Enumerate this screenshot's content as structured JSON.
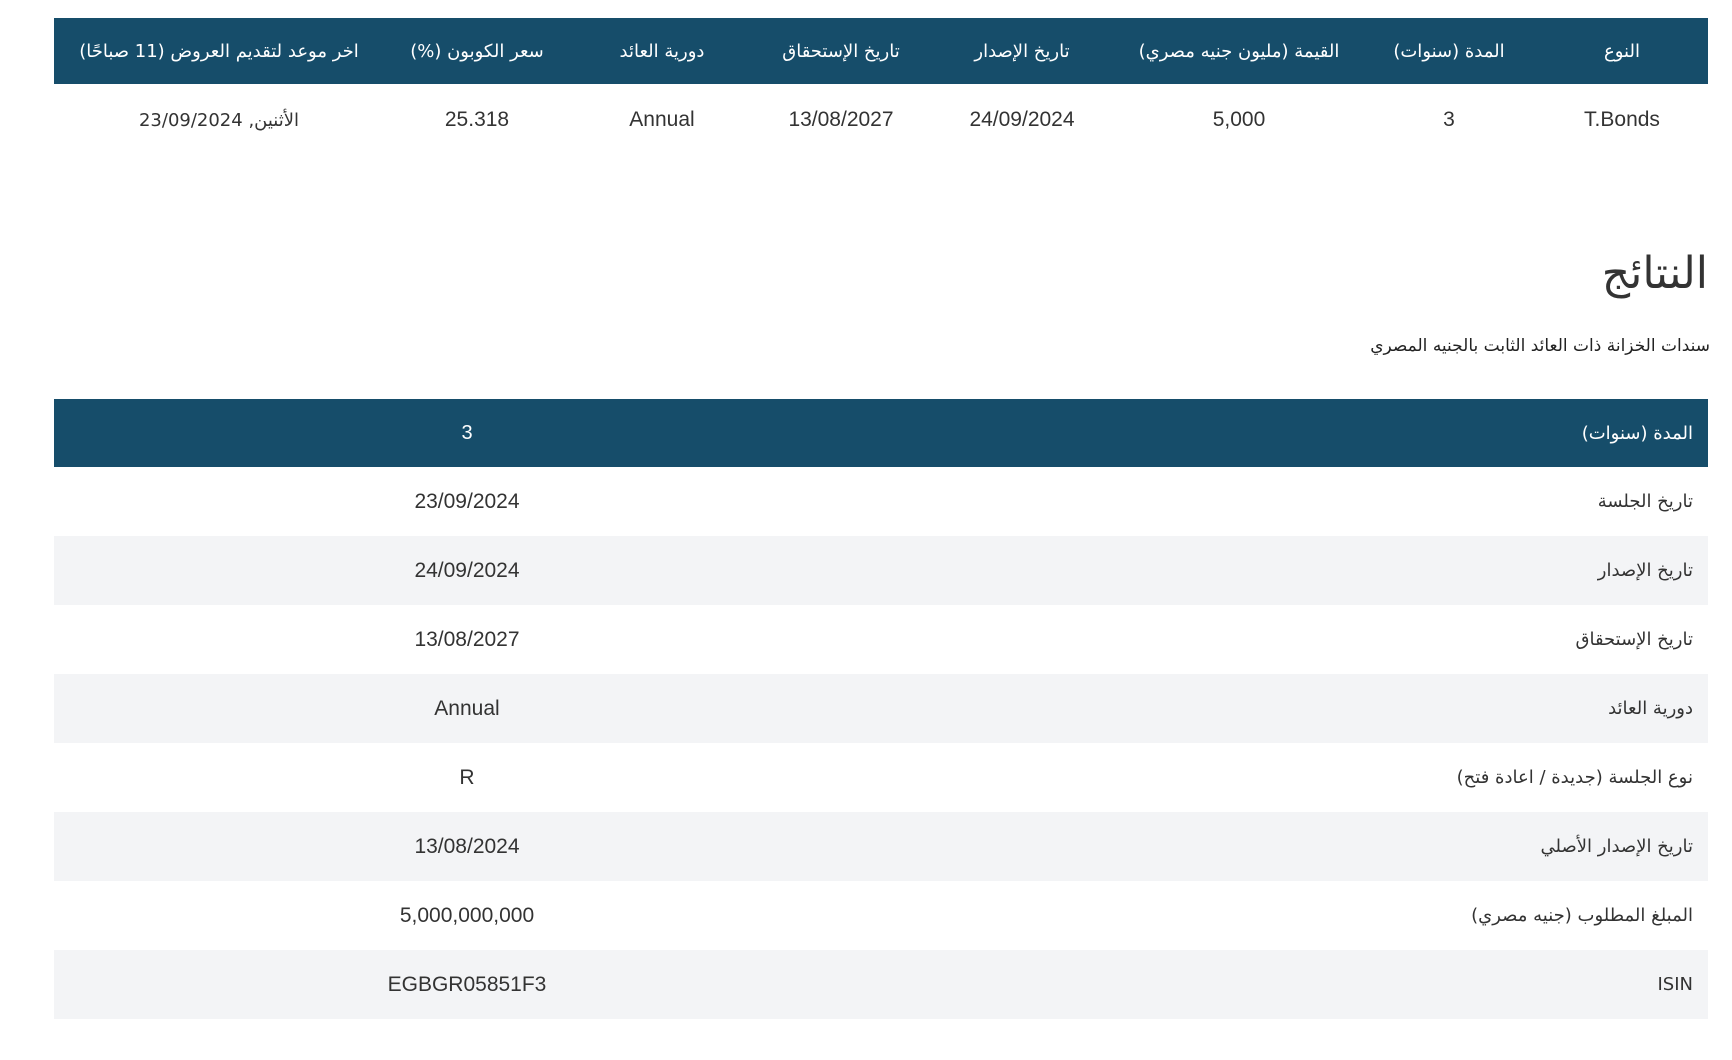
{
  "offering": {
    "headers": [
      "النوع",
      "المدة (سنوات)",
      "القيمة (مليون جنيه مصري)",
      "تاريخ الإصدار",
      "تاريخ الإستحقاق",
      "دورية العائد",
      "سعر الكوبون (%)",
      "اخر موعد لتقديم العروض (11 صباحًا)"
    ],
    "row": {
      "type": "T.Bonds",
      "tenor": "3",
      "amount": "5,000",
      "issue_date": "24/09/2024",
      "maturity_date": "13/08/2027",
      "coupon_frequency": "Annual",
      "coupon_rate": "25.318",
      "deadline": "الأثنين, 23/09/2024"
    }
  },
  "results": {
    "title": "النتائج",
    "subtitle": "سندات الخزانة ذات العائد الثابت بالجنيه المصري",
    "header": {
      "label": "المدة (سنوات)",
      "value": "3"
    },
    "rows": [
      {
        "label": "تاريخ الجلسة",
        "value": "23/09/2024"
      },
      {
        "label": "تاريخ الإصدار",
        "value": "24/09/2024"
      },
      {
        "label": "تاريخ الإستحقاق",
        "value": "13/08/2027"
      },
      {
        "label": "دورية العائد",
        "value": "Annual"
      },
      {
        "label": "نوع الجلسة (جديدة / اعادة فتح)",
        "value": "R"
      },
      {
        "label": "تاريخ الإصدار الأصلي",
        "value": "13/08/2024"
      },
      {
        "label": "المبلغ المطلوب (جنيه مصري)",
        "value": "5,000,000,000"
      },
      {
        "label": "ISIN",
        "value": "EGBGR05851F3"
      }
    ]
  },
  "colors": {
    "header_bg": "#164d6a",
    "stripe_bg": "#f3f4f6",
    "text": "#333333"
  }
}
